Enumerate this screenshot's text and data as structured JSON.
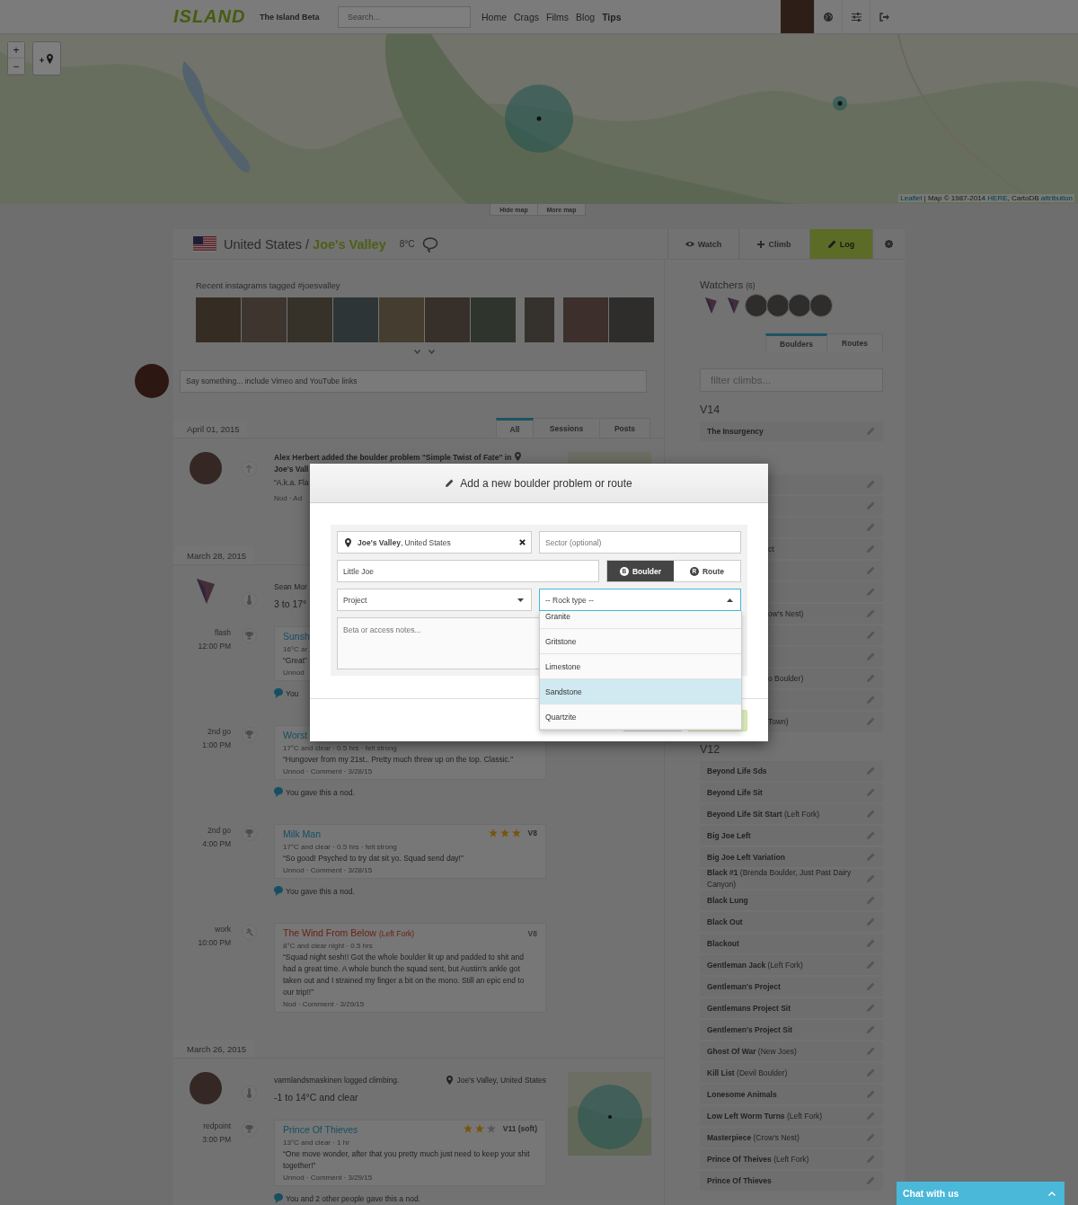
{
  "header": {
    "logo": "ISLAND",
    "site_name": "The Island Beta",
    "search": {
      "placeholder": "Search..."
    },
    "nav": [
      {
        "label": "Home",
        "emphasized": false
      },
      {
        "label": "Crags",
        "emphasized": false
      },
      {
        "label": "Films",
        "emphasized": false
      },
      {
        "label": "Blog",
        "emphasized": false
      },
      {
        "label": "Tips",
        "emphasized": true
      }
    ],
    "tools": [
      {
        "kind": "globe"
      },
      {
        "kind": "sliders"
      },
      {
        "kind": "signout"
      }
    ]
  },
  "map": {
    "zoom_in": "+",
    "zoom_out": "−",
    "attribution": [
      {
        "text": "Leaflet",
        "link": true
      },
      {
        "text": " | Map © 1987-2014 ",
        "link": false
      },
      {
        "text": "HERE",
        "link": true
      },
      {
        "text": ", CartoDB ",
        "link": false
      },
      {
        "text": "attribution",
        "link": true
      }
    ],
    "tabs": [
      "Hide map",
      "More map"
    ]
  },
  "crag": {
    "country": "United States",
    "separator": "/",
    "name": "Joe's Valley",
    "temperature": "8°C",
    "actions": [
      {
        "kind": "watch",
        "label": "Watch",
        "primary": false
      },
      {
        "kind": "climb",
        "label": "Climb",
        "primary": false
      },
      {
        "kind": "log",
        "label": "Log",
        "primary": true
      },
      {
        "kind": "settings",
        "primary": false
      }
    ]
  },
  "instagram": {
    "title": "Recent instagrams tagged #joesvalley",
    "photos": [
      {
        "narrow": false
      },
      {
        "narrow": false
      },
      {
        "narrow": false
      },
      {
        "narrow": false
      },
      {
        "narrow": false
      },
      {
        "narrow": false
      },
      {
        "narrow": false
      },
      {
        "narrow": true
      },
      {
        "narrow": false
      },
      {
        "narrow": false
      }
    ]
  },
  "post_box": {
    "placeholder": "Say something... include Vimeo and YouTube links"
  },
  "feed": {
    "tabs": [
      {
        "label": "All",
        "selected": true
      },
      {
        "label": "Sessions",
        "selected": false
      },
      {
        "label": "Posts",
        "selected": false
      }
    ],
    "days": [
      {
        "date": "April 01, 2015",
        "entries": [
          {
            "kind": "added",
            "avatar": {
              "kind": "photo"
            },
            "headline": "Alex Herbert added the boulder problem \"Simple Twist of Fate\" in",
            "place": "Joe's Vall",
            "quote": "“A.k.a. Fla",
            "footer": "Nod · Ad",
            "map": true
          }
        ]
      },
      {
        "date": "March 28, 2015",
        "entries": [
          {
            "kind": "session",
            "avatar": {
              "kind": "triangle"
            },
            "author_line": "Sean Mor",
            "conditions": "3 to 17°",
            "map": false,
            "climbs": [
              {
                "kind": "send",
                "style": "flash",
                "time": "12:00 PM",
                "title": "Sunsh",
                "details": "16°C ar",
                "quote": "“Great”",
                "footer": "Unnod",
                "nod": "You"
              },
              {
                "kind": "send",
                "style": "2nd go",
                "time": "1:00 PM",
                "title": "Worst",
                "details": "17°C and clear · 0.5 hrs · felt strong",
                "quote": "“Hungover from my 21st.. Pretty much threw up on the top. Classic.”",
                "footer": "Unnod · Comment · 3/28/15",
                "nod": "You gave this a nod."
              },
              {
                "kind": "send",
                "style": "2nd go",
                "time": "4:00 PM",
                "title": "Milk Man",
                "stars": 3,
                "grade": "V8",
                "details": "17°C and clear · 0.5 hrs · felt strong",
                "quote": "“So good! Psyched to try dat sit yo. Squad send day!”",
                "footer": "Unnod · Comment · 3/28/15",
                "nod": "You gave this a nod."
              },
              {
                "kind": "work",
                "style": "work",
                "time": "10:00 PM",
                "title": "The Wind From Below",
                "subtitle": "(Left Fork)",
                "grade": "V8",
                "details": "8°C and clear night · 0.5 hrs",
                "quote": "“Squad night sesh!! Got the whole boulder lit up and padded to shit and had a great time. A whole bunch the squad sent, but Austin's ankle got taken out and I strained my finger a bit on the mono. Still an epic end to our trip!!”",
                "footer": "Nod · Comment · 3/29/15"
              }
            ]
          }
        ]
      },
      {
        "date": "March 26, 2015",
        "entries": [
          {
            "kind": "session",
            "avatar": {
              "kind": "photo"
            },
            "author_line": "varmlandsmaskinen logged climbing.",
            "place": "Joe's Valley, United States",
            "conditions": "-1 to 14°C and clear",
            "map": true,
            "climbs": [
              {
                "kind": "send",
                "style": "redpoint",
                "time": "3:00 PM",
                "title": "Prince Of Thieves",
                "stars": 2,
                "grade": "V11 (soft)",
                "details": "13°C and clear · 1 hr",
                "quote": "“One move wonder, after that you pretty much just need to keep your shit together!”",
                "footer": "Unnod · Comment · 3/29/15",
                "nod": "You and 2 other people gave this a nod."
              }
            ]
          }
        ]
      }
    ]
  },
  "sidebar": {
    "watchers": {
      "title": "Watchers",
      "count": "(6)",
      "avatars": [
        {
          "kind": "triangle"
        },
        {
          "kind": "triangle"
        },
        {
          "kind": "photo"
        },
        {
          "kind": "photo"
        },
        {
          "kind": "photo"
        },
        {
          "kind": "photo"
        }
      ]
    },
    "tabs": [
      {
        "label": "Boulders",
        "selected": true
      },
      {
        "label": "Routes",
        "selected": false
      }
    ],
    "filter": {
      "placeholder": "filter climbs..."
    },
    "grades": [
      {
        "grade": "V14",
        "climbs": [
          {
            "kind": "named",
            "name": "The Insurgency"
          },
          {
            "kind": "covered"
          },
          {
            "kind": "covered"
          },
          {
            "kind": "covered"
          },
          {
            "kind": "covered",
            "tail": "ct"
          },
          {
            "kind": "covered"
          },
          {
            "kind": "covered"
          },
          {
            "kind": "covered",
            "tail": "ow's Nest)"
          },
          {
            "kind": "covered"
          },
          {
            "kind": "covered"
          },
          {
            "kind": "covered",
            "tail": "o Boulder)"
          },
          {
            "kind": "covered"
          },
          {
            "kind": "covered",
            "tail": "Town)"
          }
        ]
      },
      {
        "grade": "V12",
        "climbs": [
          {
            "kind": "named",
            "name": "Beyond Life Sds"
          },
          {
            "kind": "named",
            "name": "Beyond Life Sit"
          },
          {
            "kind": "named",
            "name": "Beyond Life Sit Start",
            "sector": "(Left Fork)"
          },
          {
            "kind": "named",
            "name": "Big Joe Left"
          },
          {
            "kind": "named",
            "name": "Big Joe Left Variation"
          },
          {
            "kind": "named",
            "name": "Black #1",
            "sector": "(Brenda Boulder, Just Past Dairy Canyon)"
          },
          {
            "kind": "named",
            "name": "Black Lung"
          },
          {
            "kind": "named",
            "name": "Black Out"
          },
          {
            "kind": "named",
            "name": "Blackout"
          },
          {
            "kind": "named",
            "name": "Gentleman Jack",
            "sector": "(Left Fork)"
          },
          {
            "kind": "named",
            "name": "Gentleman's Project"
          },
          {
            "kind": "named",
            "name": "Gentlemans Project Sit"
          },
          {
            "kind": "named",
            "name": "Gentlemen's Project Sit"
          },
          {
            "kind": "named",
            "name": "Ghost Of War",
            "sector": "(New Joes)"
          },
          {
            "kind": "named",
            "name": "Kill List",
            "sector": "(Devil Boulder)"
          },
          {
            "kind": "named",
            "name": "Lonesome Animals"
          },
          {
            "kind": "named",
            "name": "Low Left Worm Turns",
            "sector": "(Left Fork)"
          },
          {
            "kind": "named",
            "name": "Masterpiece",
            "sector": "(Crow's Nest)"
          },
          {
            "kind": "named",
            "name": "Prince Of Theives",
            "sector": "(Left Fork)"
          },
          {
            "kind": "named",
            "name": "Prince Of Thieves"
          }
        ]
      }
    ]
  },
  "modal": {
    "title": "Add a new boulder problem or route",
    "location": "**Joe's Valley**, United States",
    "sector": {
      "placeholder": "Sector (optional)"
    },
    "name_field": {
      "value": "Little Joe"
    },
    "type_toggle": [
      {
        "letter": "B",
        "label": "Boulder",
        "selected": true
      },
      {
        "letter": "R",
        "label": "Route",
        "selected": false
      }
    ],
    "grade_select": {
      "value": "Project"
    },
    "rock_select": {
      "value": "-- Rock type --",
      "open": true,
      "options": [
        {
          "label": "Granite",
          "selected": false
        },
        {
          "label": "Gritstone",
          "selected": false
        },
        {
          "label": "Limestone",
          "selected": false
        },
        {
          "label": "Sandstone",
          "selected": true
        },
        {
          "label": "Quartzite",
          "selected": false
        }
      ]
    },
    "notes": {
      "placeholder": "Beta or access notes..."
    }
  },
  "chat": {
    "label": "Chat with us"
  }
}
